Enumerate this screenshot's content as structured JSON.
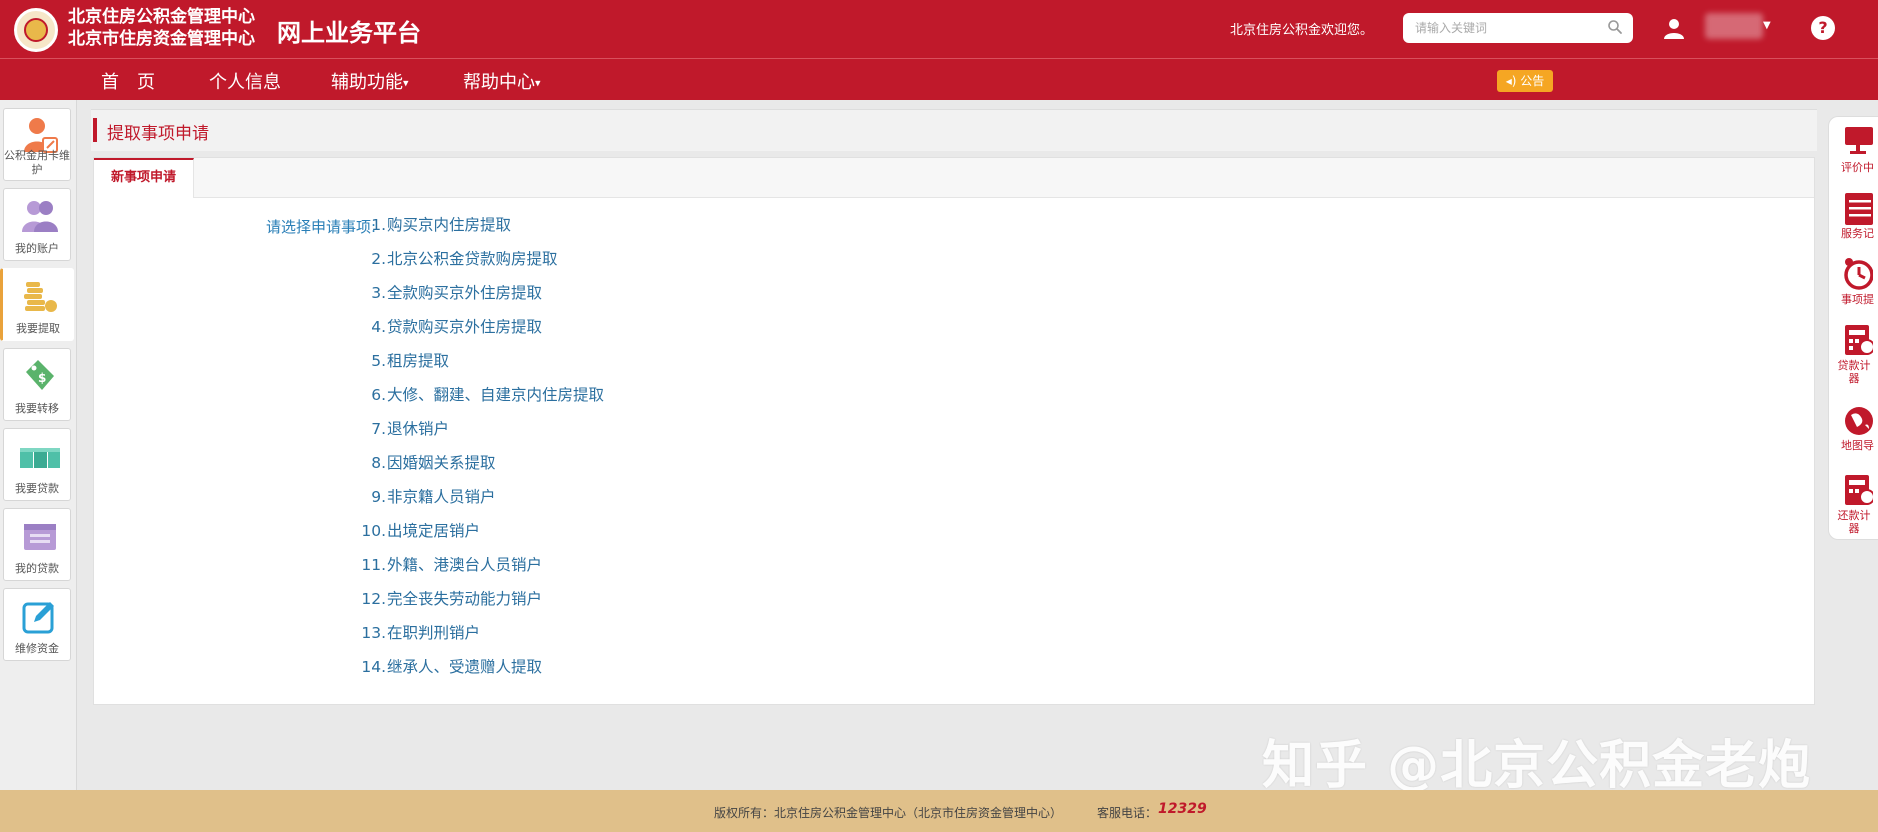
{
  "header": {
    "org_name_1": "北京住房公积金管理中心",
    "org_name_2": "北京市住房资金管理中心",
    "platform_title": "网上业务平台",
    "welcome": "北京住房公积金欢迎您。",
    "search_placeholder": "请输入关键词",
    "help_label": "?"
  },
  "nav": {
    "items": [
      {
        "label": "首　页"
      },
      {
        "label": "个人信息"
      },
      {
        "label": "辅助功能"
      },
      {
        "label": "帮助中心"
      }
    ],
    "notice": "公告"
  },
  "left_sidebar": {
    "items": [
      {
        "label": "公积金用卡维护"
      },
      {
        "label": "我的账户"
      },
      {
        "label": "我要提取"
      },
      {
        "label": "我要转移"
      },
      {
        "label": "我要贷款"
      },
      {
        "label": "我的贷款"
      },
      {
        "label": "维修资金"
      }
    ]
  },
  "main": {
    "title": "提取事项申请",
    "tab": "新事项申请",
    "prompt": "请选择申请事项:",
    "options": [
      {
        "num": "1.",
        "label": "购买京内住房提取"
      },
      {
        "num": "2.",
        "label": "北京公积金贷款购房提取"
      },
      {
        "num": "3.",
        "label": "全款购买京外住房提取"
      },
      {
        "num": "4.",
        "label": "贷款购买京外住房提取"
      },
      {
        "num": "5.",
        "label": "租房提取"
      },
      {
        "num": "6.",
        "label": "大修、翻建、自建京内住房提取"
      },
      {
        "num": "7.",
        "label": "退休销户"
      },
      {
        "num": "8.",
        "label": "因婚姻关系提取"
      },
      {
        "num": "9.",
        "label": "非京籍人员销户"
      },
      {
        "num": "10.",
        "label": "出境定居销户"
      },
      {
        "num": "11.",
        "label": "外籍、港澳台人员销户"
      },
      {
        "num": "12.",
        "label": "完全丧失劳动能力销户"
      },
      {
        "num": "13.",
        "label": "在职判刑销户"
      },
      {
        "num": "14.",
        "label": "继承人、受遗赠人提取"
      }
    ]
  },
  "right_sidebar": {
    "items": [
      {
        "label": "评价中"
      },
      {
        "label": "服务记"
      },
      {
        "label": "事项提"
      },
      {
        "label": "贷款计器"
      },
      {
        "label": "地图导"
      },
      {
        "label": "还款计器"
      }
    ]
  },
  "watermark": "知乎 @北京公积金老炮",
  "footer": {
    "copyright": "版权所有：北京住房公积金管理中心（北京市住房资金管理中心）",
    "hotline_label": "客服电话：",
    "hotline": "12329"
  },
  "colors": {
    "brand_red": "#c0192b",
    "link_blue": "#2b6f9f",
    "footer_tan": "#e0c08a",
    "notice_orange": "#f5a623"
  }
}
